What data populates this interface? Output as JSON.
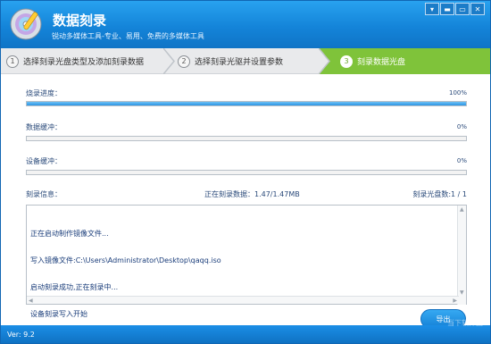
{
  "app": {
    "title": "数据刻录",
    "subtitle": "锐动多媒体工具-专业、易用、免费的多媒体工具",
    "window_buttons": [
      "▾",
      "▬",
      "▭",
      "✕"
    ]
  },
  "steps": [
    {
      "num": "1",
      "label": "选择刻录光盘类型及添加刻录数据",
      "active": false
    },
    {
      "num": "2",
      "label": "选择刻录光驱并设置参数",
      "active": false
    },
    {
      "num": "3",
      "label": "刻录数据光盘",
      "active": true
    }
  ],
  "progress": {
    "burn": {
      "label": "烧录进度：",
      "value": 100,
      "text": "100%"
    },
    "data_buffer": {
      "label": "数据缓冲：",
      "value": 0,
      "text": "0%"
    },
    "device_buffer": {
      "label": "设备缓冲：",
      "value": 0,
      "text": "0%"
    }
  },
  "burn_info": {
    "label": "刻录信息：",
    "burning_data": "正在刻录数据：1.47/1.47MB",
    "disc_count": "刻录光盘数:1 / 1"
  },
  "log": [
    "正在启动制作镜像文件...",
    "写入镜像文件:C:\\Users\\Administrator\\Desktop\\qaqq.iso",
    "启动刻录成功,正在刻录中...",
    "设备刻录写入开始"
  ],
  "export_button": "导出",
  "version": "Ver: 9.2",
  "watermark": "当下软件园",
  "colors": {
    "brand_blue": "#1484d9",
    "step_active": "#7fc33a",
    "progress_fill": "#2b94e3"
  }
}
